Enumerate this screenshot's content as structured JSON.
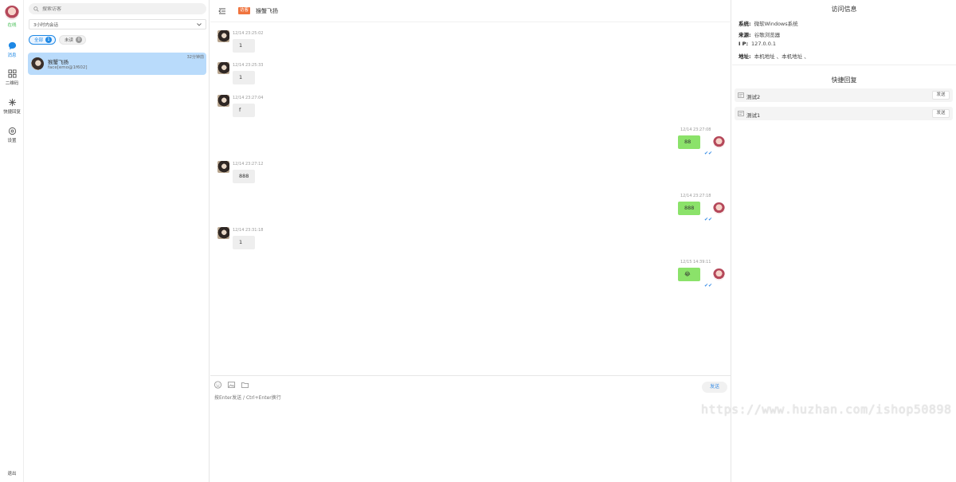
{
  "rail": {
    "status": "在线",
    "nav": [
      {
        "label": "消息",
        "icon": "chat-bubble-icon"
      },
      {
        "label": "二维码",
        "icon": "qrcode-grid-icon"
      },
      {
        "label": "快捷回复",
        "icon": "sparkle-icon"
      },
      {
        "label": "设置",
        "icon": "gear-icon"
      }
    ],
    "logout": "退出"
  },
  "sessions": {
    "search_placeholder": "搜索访客",
    "filter": "3小时内会话",
    "tabs": [
      {
        "label": "全部",
        "count": "1"
      },
      {
        "label": "未读",
        "count": "0"
      }
    ],
    "items": [
      {
        "name": "猴蟹飞扬",
        "snippet": "face[emo@1f602]",
        "time": "32分钟前"
      }
    ]
  },
  "chat": {
    "badge": "访客",
    "title": "猴蟹飞扬",
    "messages": [
      {
        "dir": "in",
        "time": "12/14 23:25:02",
        "text": "1"
      },
      {
        "dir": "in",
        "time": "12/14 23:25:33",
        "text": "1"
      },
      {
        "dir": "in",
        "time": "12/14 23:27:04",
        "text": "f"
      },
      {
        "dir": "out",
        "time": "12/14 23:27:08",
        "text": "88"
      },
      {
        "dir": "in",
        "time": "12/14 23:27:12",
        "text": "888"
      },
      {
        "dir": "out",
        "time": "12/14 23:27:18",
        "text": "888"
      },
      {
        "dir": "in",
        "time": "12/14 23:31:18",
        "text": "1"
      },
      {
        "dir": "out",
        "time": "12/15 14:39:11",
        "text": "😂"
      }
    ],
    "composer": {
      "placeholder": "按Enter发送 / Ctrl+Enter换行",
      "send": "发送"
    }
  },
  "info": {
    "visit_title": "访问信息",
    "fields": [
      {
        "label": "系统:",
        "value": "微软Windows系统"
      },
      {
        "label": "来源:",
        "value": "谷歌浏览器"
      },
      {
        "label": "I P:",
        "value": "127.0.0.1"
      },
      {
        "label": "地址:",
        "value": "本机地址 、本机地址 、"
      }
    ],
    "quick_title": "快捷回复",
    "quick": [
      {
        "label": "测试2",
        "send": "发送"
      },
      {
        "label": "测试1",
        "send": "发送"
      }
    ]
  },
  "watermark": "https://www.huzhan.com/ishop50898",
  "colors": {
    "accent": "#1e88e5",
    "online": "#3dbb4d",
    "out_bubble": "#8be26a",
    "badge": "#f0743e",
    "selected": "#b9dbfb"
  }
}
